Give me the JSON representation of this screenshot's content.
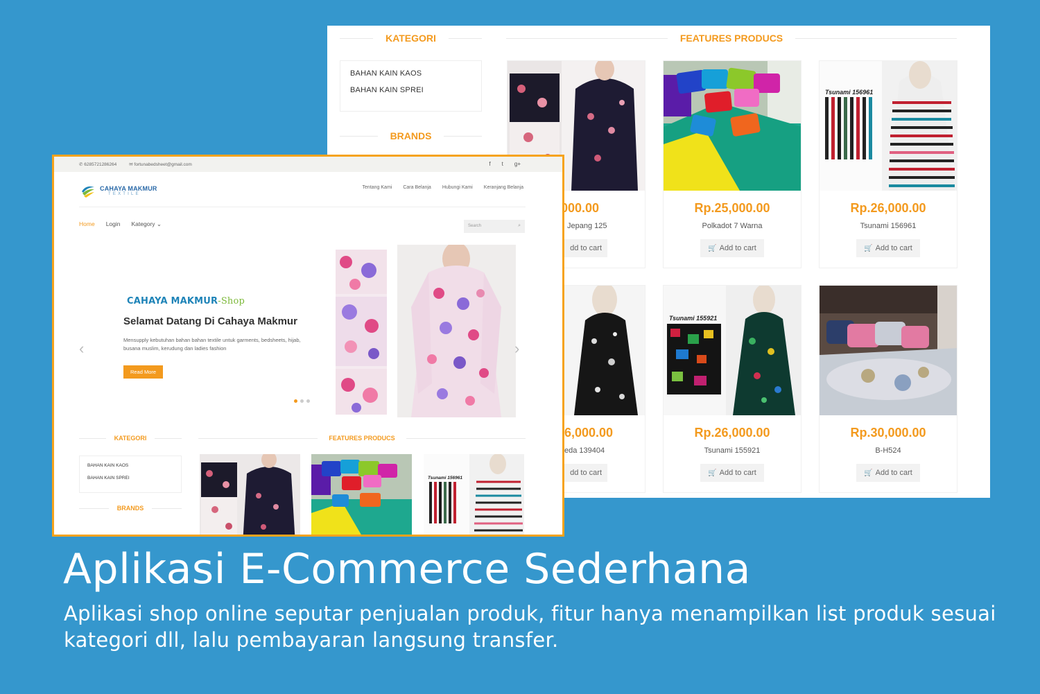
{
  "back_page": {
    "kategori_heading": "KATEGORI",
    "brands_heading": "BRANDS",
    "features_heading": "FEATURES PRODUCS",
    "kategori_items": [
      "BAHAN KAIN KAOS",
      "BAHAN KAIN SPREI"
    ],
    "products": [
      {
        "price": "0,000.00",
        "name": "Jepang 125",
        "cart": "dd to cart"
      },
      {
        "price": "Rp.25,000.00",
        "name": "Polkadot 7 Warna",
        "cart": "Add to cart"
      },
      {
        "price": "Rp.26,000.00",
        "name": "Tsunami 156961",
        "cart": "Add to cart",
        "label": "Tsunami 156961"
      },
      {
        "price": "6,000.00",
        "name": "eda 139404",
        "cart": "dd to cart"
      },
      {
        "price": "Rp.26,000.00",
        "name": "Tsunami 155921",
        "cart": "Add to cart",
        "label": "Tsunami 155921"
      },
      {
        "price": "Rp.30,000.00",
        "name": "B-H524",
        "cart": "Add to cart"
      }
    ]
  },
  "front_page": {
    "phone": "6285721286264",
    "email": "fortunabedsheet@gmail.com",
    "social": [
      "f",
      "t",
      "g+"
    ],
    "logo_name": "CAHAYA MAKMUR",
    "logo_sub": "TEXTILE",
    "top_links": [
      "Tentang Kami",
      "Cara Belanja",
      "Hubungi Kami",
      "Keranjang Belanja"
    ],
    "nav": {
      "home": "Home",
      "login": "Login",
      "kategory": "Kategory"
    },
    "search_placeholder": "Search",
    "hero": {
      "brand": "CAHAYA MAKMUR",
      "brand_suffix": "-Shop",
      "title": "Selamat Datang Di Cahaya Makmur",
      "desc": "Mensupply kebutuhan bahan bahan textile untuk garments, bedsheets, hijab, busana muslim, kerudung dan ladies fashion",
      "button": "Read More"
    },
    "kategori_heading": "KATEGORI",
    "features_heading": "FEATURES PRODUCS",
    "brands_heading": "BRANDS",
    "kategori_items": [
      "BAHAN KAIN KAOS",
      "BAHAN KAIN SPREI"
    ],
    "thumb_label": "Tsunami 156961"
  },
  "caption": {
    "title": "Aplikasi E-Commerce Sederhana",
    "subtitle": "Aplikasi shop online seputar penjualan produk, fitur hanya menampilkan list produk sesuai kategori dll, lalu pembayaran langsung transfer."
  },
  "colors": {
    "background": "#3597cd",
    "accent": "#f39a1e",
    "brand_blue": "#1f84b8",
    "brand_green": "#7db93a"
  }
}
